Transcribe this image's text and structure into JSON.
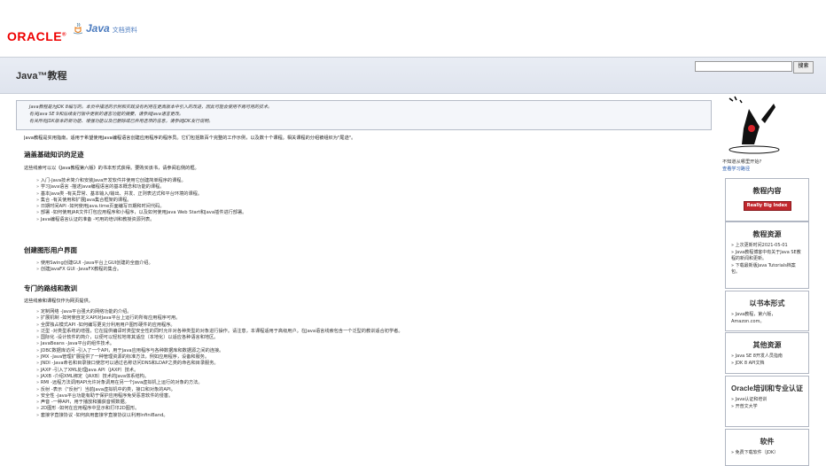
{
  "header": {
    "oracle_logo": "ORACLE",
    "java_logo": "Java",
    "java_doc_text": "文档资料"
  },
  "band": {
    "title": "Java™教程",
    "search_placeholder": "",
    "search_button": "搜索"
  },
  "notice": {
    "lines": [
      "Java教程是为JDK 8编写的。本页中描述的示例和实践没有利用在更高版本中引入的改进，因此可能会使用不再可用的技术。",
      "有关Java SE 9和后续发行版中更新的语言功能的摘要，请参阅Java语言更改。",
      "有关所有JDK版本的新功能、增强功能以及已删除或已弃用选项的信息，请参阅JDK发行说明。"
    ]
  },
  "intro": "Java教程是实用指南，适用于希望使用Java编程语言创建应用程序的程序员。它们包括数百个完整的工作示例，以及数十个课程。相关课程的分组被组织为\"尾迹\"。",
  "section1": {
    "heading": "涵盖基础知识的足迹",
    "desc": "这些线索可以以《Java教程第六版》的书本形式获得。要购买该书，请参阅右侧的框。",
    "items": [
      "入门-Java技术简介和安装Java开发软件并使用它创建简单程序的课程。",
      "学习Java语言 -描述Java编程语言的基本概念和功能的课程。",
      "基本Java类 -有关异常、基本输入/输出、并发、正则表达式和平台环境的课程。",
      "集合 -有关使用和扩展Java集合框架的课程。",
      "日期时间API -如何使用java.time页面编写日期和时间代码。",
      "部署 -如何使用JAR文件打包应用程序和小程序，以及如何使用Java Web Start和Java插件进行部署。",
      "Java编程语言认证的准备 -可用的培训和教授资源列表。"
    ]
  },
  "section2": {
    "heading": "创建图形用户界面",
    "items": [
      "使用Swing创建GUI -Java平台上GUI创建的全面介绍。",
      "创建JavaFX GUI -JavaFX教程的集合。"
    ]
  },
  "section3": {
    "heading": "专门的路线和教训",
    "desc": "这些线索和课程仅作为网页提供。",
    "items": [
      "定制网络 -Java平台强大的网络功能的介绍。",
      "扩展机制 -如何使自定义API对Java平台上运行的所有应用程序可用。",
      "全屏独占模式API -如何编写更充分利用用户图形硬件的应用程序。",
      "泛型 -对类型系统的增强，它在提供编译时类型安全性的同时允许对各种类型的对象进行操作。请注意，本课程适用于高级用户。在Java语言线索包含一个泛型的教训适合初学者。",
      "国际化 -设计软件的简介，以便可以轻松地将其适应（本地化）以适应各种语言和地区。",
      "JavaBeans -Java平台的组件技术。",
      "JDBC数据库访问 -引入了一个API，用于Java应用程序与各种数据库和数据源之间的连接。",
      "JMX -Java管理扩展提供了一种管理资源的标准方法，例如应用程序，设备和服务。",
      "JNDI -Java命名和目录接口使您可以通过名称访问DNS和LDAP之类的命名和目录服务。",
      "JAXP -引入了XML处理Java API（JAXP）技术。",
      "JAXB -介绍XML绑定（JAXB）技术的Java体系结构。",
      "RMI -远程方法调用API允许对象调用在另一个Java虚拟机上运行的对象的方法。",
      "反射 -表示（\"反射\"）当前Java虚拟机中的类，接口和对象的API。",
      "安全性 -Java平台功能有助于保护应用程序免受恶意软件的侵害。",
      "声音 -一种API，用于播放和捕获音频数据。",
      "2D图形 -如何在应用程序中显示和打印2D图形。",
      "套接字直接协议 -如何启用套接字直接协议以利用InfiniBand。"
    ]
  },
  "sidebar": {
    "note_line1": "不知道从哪里开始?",
    "note_line2": "查看学习路径",
    "box1": {
      "heading": "教程内容",
      "button": "Really Big Index"
    },
    "box2": {
      "heading": "教程资源",
      "items": [
        "上次更新时间2021-05-01",
        "Java教程博客中有关于Java SE教程的新闻和更新。",
        "下载最新版Java Tutorials档案包。"
      ]
    },
    "box3": {
      "heading": "以书本形式",
      "items": [
        "Java教程，第六版，Amazon.com。"
      ]
    },
    "box4": {
      "heading": "其他资源",
      "items": [
        "Java SE 8开发人员指南",
        "JDK 8 API文档"
      ]
    },
    "box5": {
      "heading": "Oracle培训和专业认证",
      "items": [
        "Java认证和培训",
        "开普文大学"
      ]
    },
    "box6": {
      "heading": "软件",
      "items": [
        "免费下载软件（JDK）"
      ]
    }
  },
  "colors": {
    "oracle_red": "#ee0000",
    "link_blue": "#2255aa",
    "button_red": "#c1272d"
  }
}
